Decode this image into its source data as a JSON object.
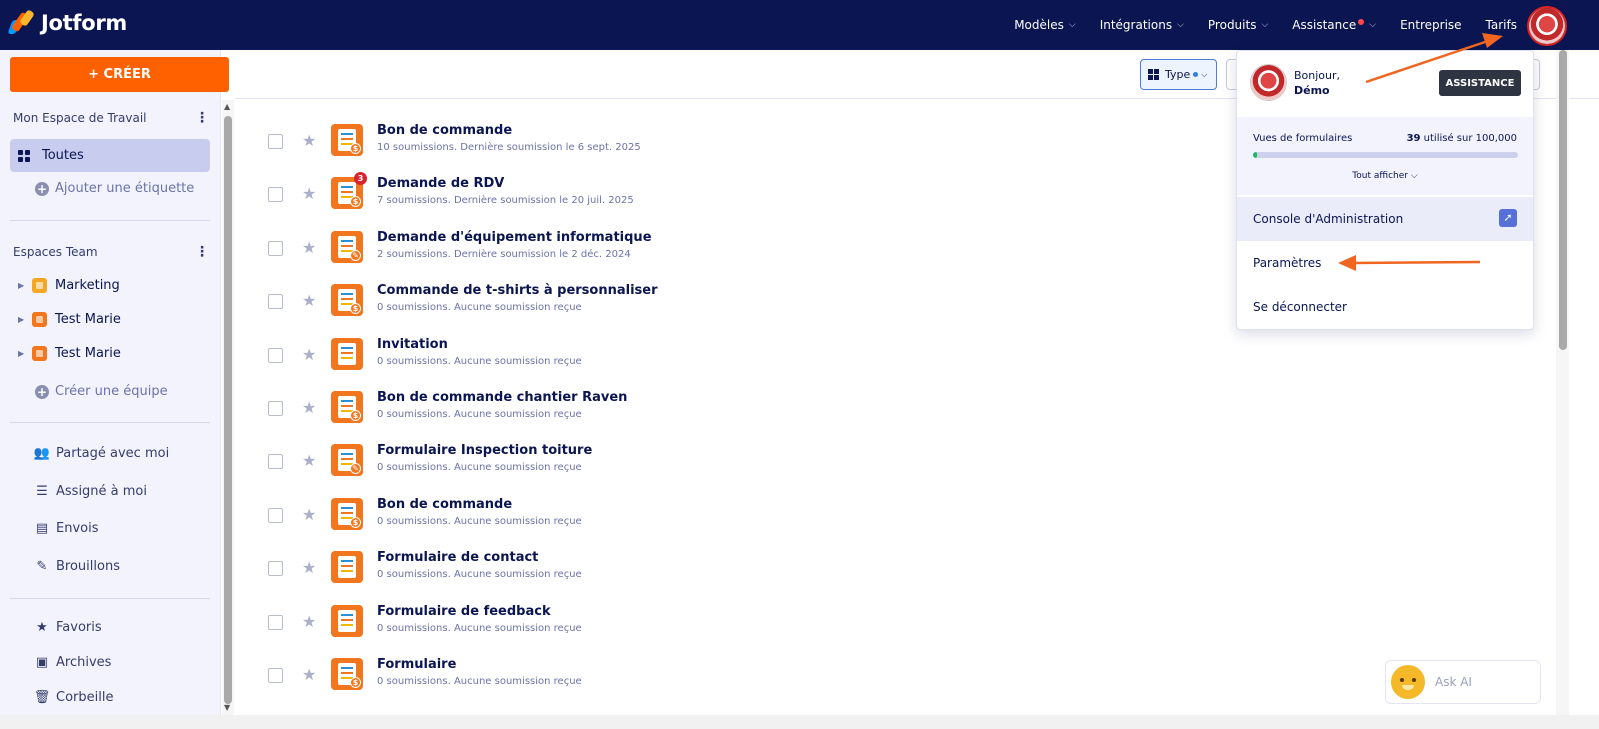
{
  "brand": {
    "name": "Jotform",
    "colors": {
      "nav_bg": "#0a1551",
      "accent": "#ff6100",
      "form_icon": "#f2761e"
    }
  },
  "topnav": {
    "items": [
      {
        "label": "Modèles",
        "has_chevron": true
      },
      {
        "label": "Intégrations",
        "has_chevron": true
      },
      {
        "label": "Produits",
        "has_chevron": true
      },
      {
        "label": "Assistance",
        "has_chevron": true,
        "has_dot": true
      },
      {
        "label": "Entreprise",
        "has_chevron": false
      },
      {
        "label": "Tarifs",
        "has_chevron": false
      }
    ],
    "avatar_icon": "user-avatar"
  },
  "sidebar": {
    "create_label": "+ CRÉER",
    "workspace_title": "Mon Espace de Travail",
    "all_label": "Toutes",
    "add_tag_label": "Ajouter une étiquette",
    "teams_title": "Espaces Team",
    "teams": [
      {
        "label": "Marketing",
        "color": "#f5a623"
      },
      {
        "label": "Test Marie",
        "color": "#f2761e"
      },
      {
        "label": "Test Marie",
        "color": "#f2761e"
      }
    ],
    "create_team_label": "Créer une équipe",
    "links": [
      {
        "label": "Partagé avec moi",
        "icon": "shared-users-icon"
      },
      {
        "label": "Assigné à moi",
        "icon": "assigned-list-icon"
      },
      {
        "label": "Envois",
        "icon": "inbox-icon"
      },
      {
        "label": "Brouillons",
        "icon": "draft-icon"
      }
    ],
    "bottom_links": [
      {
        "label": "Favoris",
        "icon": "star-icon"
      },
      {
        "label": "Archives",
        "icon": "archive-icon"
      },
      {
        "label": "Corbeille",
        "icon": "trash-icon"
      }
    ]
  },
  "toolbar": {
    "type_label": "Type"
  },
  "forms": [
    {
      "title": "Bon de commande",
      "meta": "10 soumissions. Dernière soumission le 6 sept. 2025",
      "icon": "payment-form-icon",
      "badge": ""
    },
    {
      "title": "Demande de RDV",
      "meta": "7 soumissions. Dernière soumission le 20 juil. 2025",
      "icon": "payment-form-icon",
      "badge": "3"
    },
    {
      "title": "Demande d'équipement informatique",
      "meta": "2 soumissions. Dernière soumission le 2 déc. 2024",
      "icon": "edit-form-icon",
      "badge": ""
    },
    {
      "title": "Commande de t-shirts à personnaliser",
      "meta": "0 soumissions. Aucune soumission reçue",
      "icon": "payment-form-icon",
      "badge": ""
    },
    {
      "title": "Invitation",
      "meta": "0 soumissions. Aucune soumission reçue",
      "icon": "form-icon",
      "badge": ""
    },
    {
      "title": "Bon de commande chantier Raven",
      "meta": "0 soumissions. Aucune soumission reçue",
      "icon": "payment-form-icon",
      "badge": ""
    },
    {
      "title": "Formulaire Inspection toiture",
      "meta": "0 soumissions. Aucune soumission reçue",
      "icon": "edit-form-icon",
      "badge": ""
    },
    {
      "title": "Bon de commande",
      "meta": "0 soumissions. Aucune soumission reçue",
      "icon": "payment-form-icon",
      "badge": ""
    },
    {
      "title": "Formulaire de contact",
      "meta": "0 soumissions. Aucune soumission reçue",
      "icon": "form-icon",
      "badge": ""
    },
    {
      "title": "Formulaire de feedback",
      "meta": "0 soumissions. Aucune soumission reçue",
      "icon": "form-icon",
      "badge": ""
    },
    {
      "title": "Formulaire",
      "meta": "0 soumissions. Aucune soumission reçue",
      "icon": "payment-form-icon",
      "badge": ""
    }
  ],
  "account_menu": {
    "greeting": "Bonjour,",
    "user_name": "Démo",
    "assistance_label": "ASSISTANCE",
    "usage": {
      "label": "Vues de formulaires",
      "used": "39",
      "suffix": "utilisé sur 100,000",
      "fraction": 0.0004
    },
    "show_all_label": "Tout afficher",
    "admin_console_label": "Console d'Administration",
    "settings_label": "Paramètres",
    "logout_label": "Se déconnecter"
  },
  "ask_ai": {
    "label": "Ask AI"
  }
}
